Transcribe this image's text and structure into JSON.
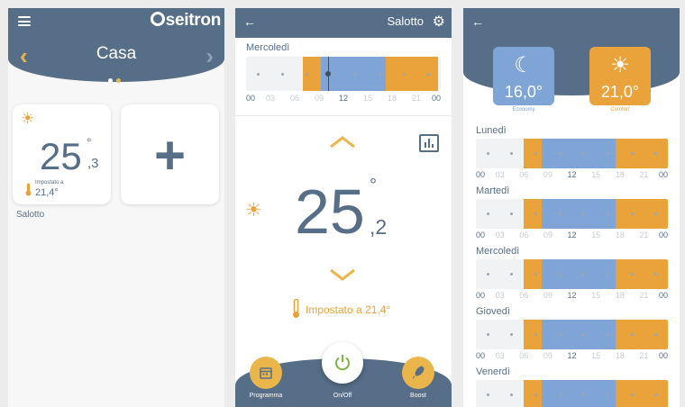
{
  "colors": {
    "navy": "#566e87",
    "orange": "#eaa33a",
    "blue": "#7ea5d6",
    "bar_bg": "#f1f2f4",
    "accent_yellow": "#eab54b"
  },
  "home": {
    "brand": "seitron",
    "title": "Casa",
    "rooms": [
      {
        "name": "Salotto",
        "temp_int": "25",
        "temp_dec": ",3",
        "deg": "°",
        "set_label": "Impostato a",
        "set_value": "21,4°",
        "icon": "sun-icon"
      }
    ],
    "add_symbol": "+"
  },
  "room": {
    "title": "Salotto",
    "day": "Mercoledì",
    "ticks": [
      "00",
      "03",
      "06",
      "09",
      "12",
      "15",
      "18",
      "21",
      "00"
    ],
    "temp_int": "25",
    "temp_dec": ",2",
    "deg": "°",
    "set_text": "Impostato a 21,4°",
    "toolbar": [
      {
        "label": "Programma",
        "icon": "calendar-icon"
      },
      {
        "label": "On/Off",
        "icon": "power-icon"
      },
      {
        "label": "Boost",
        "icon": "rocket-icon"
      }
    ]
  },
  "schedule": {
    "modes": [
      {
        "value": "16,0°",
        "label": "Economy",
        "icon": "moon-icon"
      },
      {
        "value": "21,0°",
        "label": "Comfort",
        "icon": "sun-icon"
      }
    ],
    "days": [
      "Lunedì",
      "Martedì",
      "Mercoledì",
      "Giovedì",
      "Venerdì"
    ],
    "ticks": [
      "00",
      "03",
      "06",
      "09",
      "12",
      "15",
      "18",
      "21",
      "00"
    ]
  }
}
